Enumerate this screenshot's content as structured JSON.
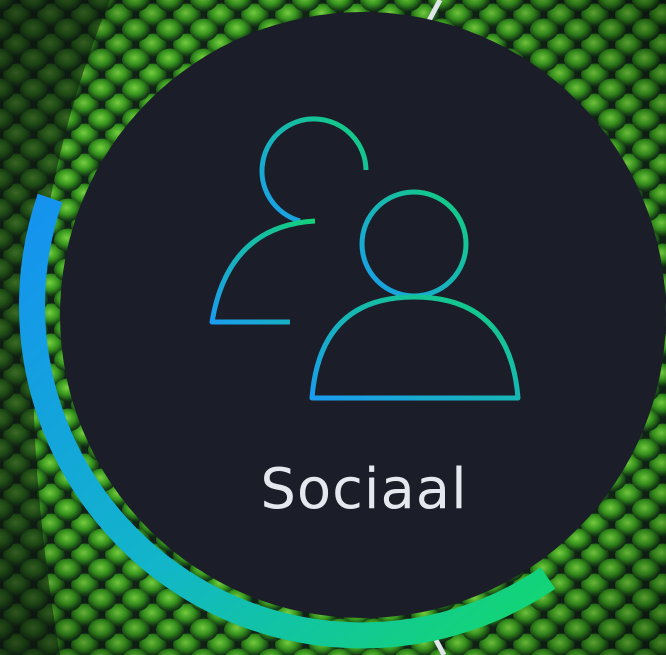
{
  "badge": {
    "label": "Sociaal",
    "icon": "users-icon",
    "progress": 0.55
  },
  "colors": {
    "circle_fill": "#1b1e28",
    "text": "#e6e8ef",
    "gradient_start": "#1aa8e8",
    "gradient_end": "#13d86c",
    "scale_dark": "#16261a",
    "scale_light": "#5fe03a"
  }
}
